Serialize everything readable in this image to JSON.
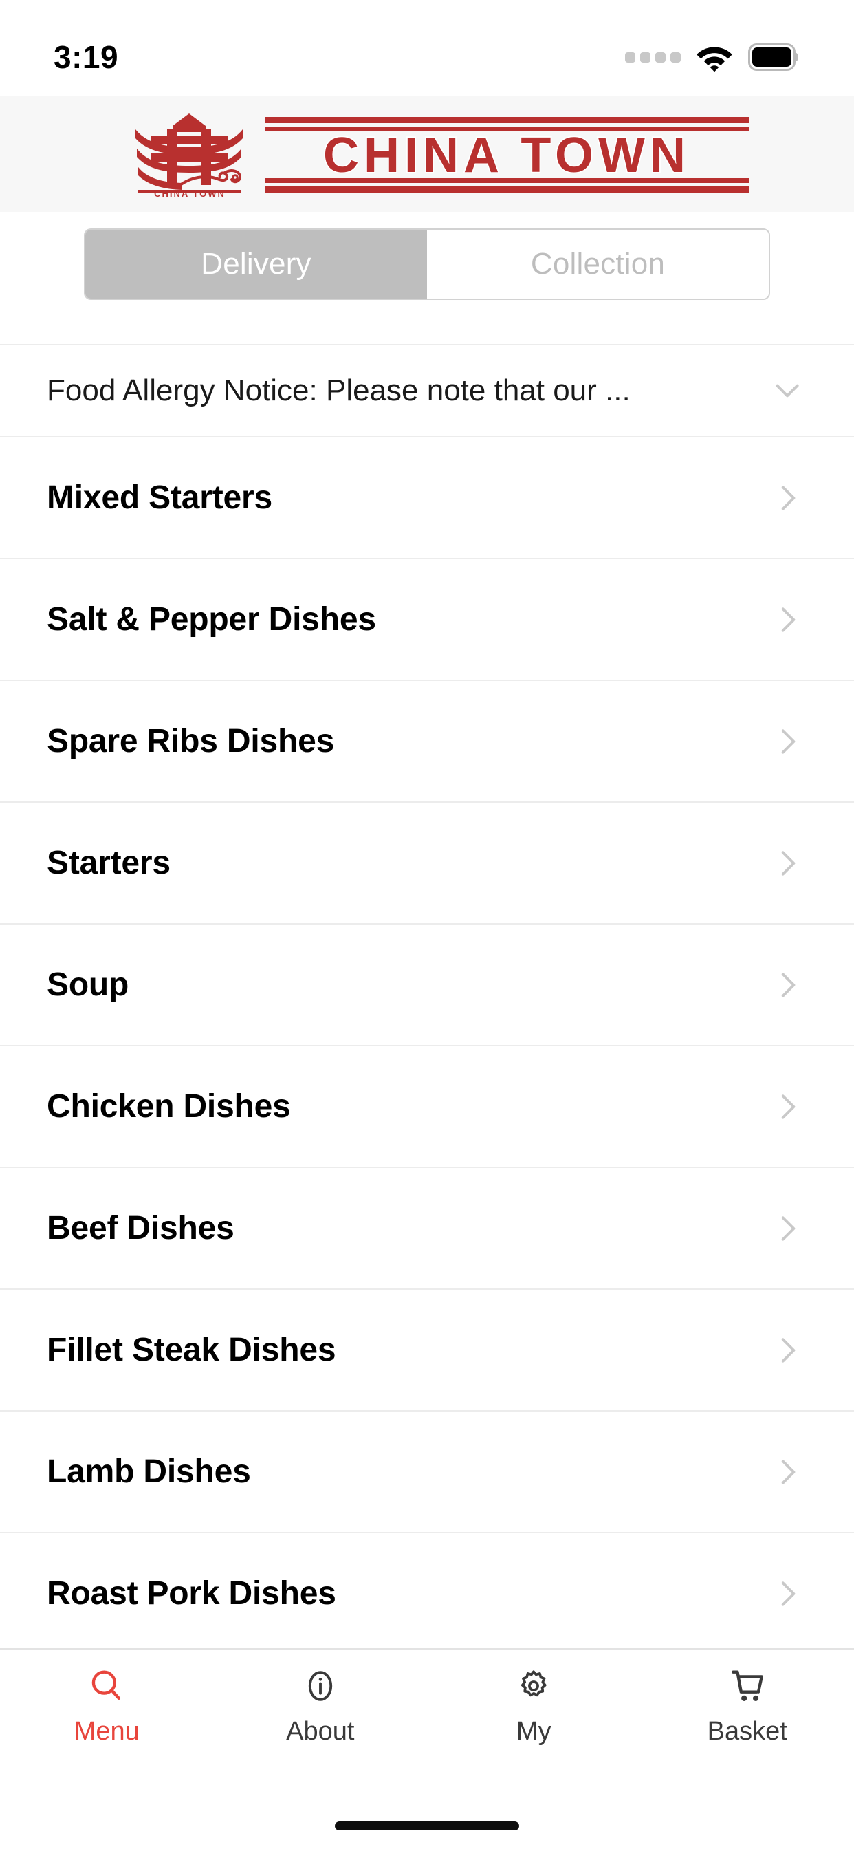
{
  "status_bar": {
    "time": "3:19",
    "signal_icon": "signal-dots-icon",
    "wifi_icon": "wifi-icon",
    "battery_icon": "battery-full-icon"
  },
  "header": {
    "brand_name": "CHINA TOWN",
    "logo_caption": "CHINA TOWN",
    "logo_icon": "pagoda-logo-icon",
    "background": "#f7f7f7",
    "brand_color": "#b8302f"
  },
  "order_mode": {
    "selected": "Delivery",
    "options": [
      {
        "label": "Delivery",
        "active": true
      },
      {
        "label": "Collection",
        "active": false
      }
    ],
    "active_background": "#bebebe",
    "active_text_color": "#ffffff",
    "inactive_text_color": "#bdbdbd"
  },
  "notice": {
    "text": "Food Allergy Notice: Please note that our ...",
    "expand_icon": "chevron-down-icon"
  },
  "menu_categories": [
    {
      "label": "Mixed Starters",
      "chevron": "chevron-right-icon"
    },
    {
      "label": "Salt & Pepper Dishes",
      "chevron": "chevron-right-icon"
    },
    {
      "label": "Spare Ribs Dishes",
      "chevron": "chevron-right-icon"
    },
    {
      "label": "Starters",
      "chevron": "chevron-right-icon"
    },
    {
      "label": "Soup",
      "chevron": "chevron-right-icon"
    },
    {
      "label": "Chicken Dishes",
      "chevron": "chevron-right-icon"
    },
    {
      "label": "Beef Dishes",
      "chevron": "chevron-right-icon"
    },
    {
      "label": "Fillet Steak Dishes",
      "chevron": "chevron-right-icon"
    },
    {
      "label": "Lamb Dishes",
      "chevron": "chevron-right-icon"
    },
    {
      "label": "Roast Pork Dishes",
      "chevron": "chevron-right-icon"
    }
  ],
  "tab_bar": {
    "active_color": "#e8453c",
    "inactive_color": "#3a3a3a",
    "tabs": [
      {
        "label": "Menu",
        "icon": "search-icon",
        "active": true
      },
      {
        "label": "About",
        "icon": "info-circle-icon",
        "active": false
      },
      {
        "label": "My",
        "icon": "gear-icon",
        "active": false
      },
      {
        "label": "Basket",
        "icon": "shopping-cart-icon",
        "active": false
      }
    ]
  }
}
